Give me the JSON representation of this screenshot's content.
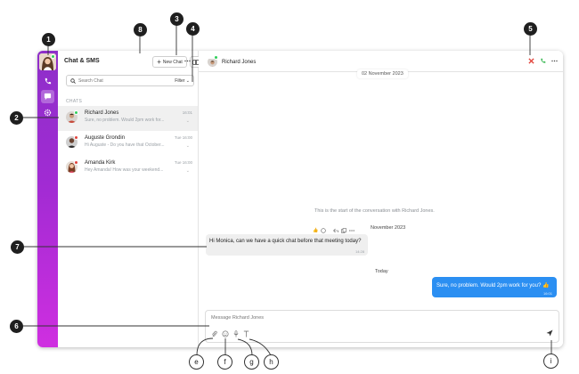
{
  "panel": {
    "title": "Chat & SMS",
    "new_chat_label": "New Chat",
    "search_placeholder": "Search Chat",
    "filter_label": "Filter",
    "section_label": "CHATS"
  },
  "chats": [
    {
      "name": "Richard Jones",
      "preview": "Sure, no problem. Would 2pm work for...",
      "time": "16:01",
      "status_color": "#2fcf5a"
    },
    {
      "name": "Auguste Grondin",
      "preview": "Hi Auguste - Do you have that October...",
      "time": "Tue 16:00",
      "status_color": "#e2433b"
    },
    {
      "name": "Amanda Kirk",
      "preview": "Hey Amanda! How was your weekend...",
      "time": "Tue 16:00",
      "status_color": "#e2433b"
    }
  ],
  "conversation": {
    "contact_name": "Richard Jones",
    "date_top": "02 November 2023",
    "start_note": "This is the start of the conversation with Richard Jones.",
    "date_mid": "November 2023",
    "incoming": {
      "text": "Hi Monica, can we have a quick chat before that meeting today?",
      "time": "14:28"
    },
    "date_today": "Today",
    "outgoing": {
      "text": "Sure, no problem. Would 2pm work for you? 👍",
      "time": "16:01"
    },
    "composer_placeholder": "Message Richard Jones"
  },
  "callouts": {
    "c1": "1",
    "c2": "2",
    "c3": "3",
    "c4": "4",
    "c5": "5",
    "c6": "6",
    "c7": "7",
    "c8": "8",
    "ce": "e",
    "cf": "f",
    "cg": "g",
    "ch": "h",
    "ci": "i"
  },
  "colors": {
    "accent": "#2b8ff2",
    "rail_top": "#8e2fc9",
    "rail_bottom": "#cf2fe0",
    "online": "#2fcf5a",
    "away": "#e2433b"
  },
  "icons": [
    "phone-icon",
    "chat-bubble-icon",
    "gear-icon",
    "search-icon",
    "chevron-down-icon",
    "close-icon",
    "more-icon",
    "attach-icon",
    "emoji-icon",
    "mic-icon",
    "text-format-icon",
    "send-icon"
  ]
}
